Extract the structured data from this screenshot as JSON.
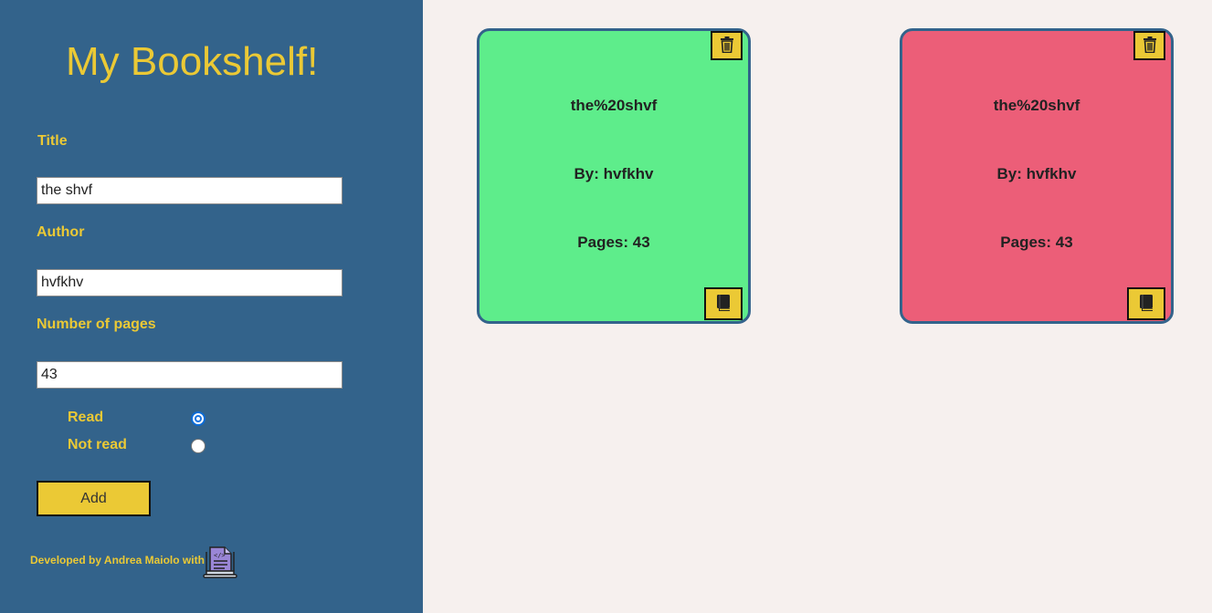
{
  "sidebar": {
    "title": "My Bookshelf!",
    "title_label": "Title",
    "title_value": "the shvf",
    "author_label": "Author",
    "author_value": "hvfkhv",
    "pages_label": "Number of pages",
    "pages_value": "43",
    "read_label": "Read",
    "not_read_label": "Not read",
    "read_selected": "Read",
    "add_label": "Add",
    "footer": "Developed by Andrea Maiolo with"
  },
  "books": [
    {
      "title": "the%20shvf",
      "author": "By: hvfkhv",
      "pages": "Pages: 43",
      "status": "read",
      "color": "#5eed8b"
    },
    {
      "title": "the%20shvf",
      "author": "By: hvfkhv",
      "pages": "Pages: 43",
      "status": "not read",
      "color": "#ec5e78"
    }
  ],
  "colors": {
    "sidebar_bg": "#33638b",
    "accent": "#ebc935",
    "page_bg": "#f6f0ee"
  },
  "icons": {
    "delete": "trash-icon",
    "toggle": "book-icon",
    "developer": "laptop-code-icon"
  }
}
